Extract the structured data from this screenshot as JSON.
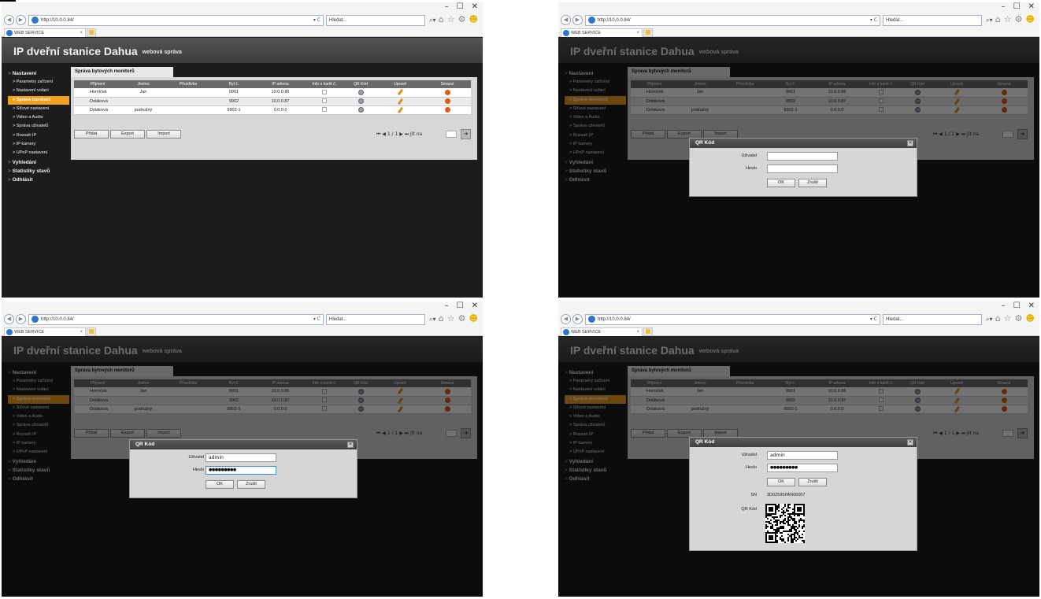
{
  "browser": {
    "window_controls": [
      "–",
      "☐",
      "✕"
    ],
    "address": "http://10.0.0.84/",
    "address_tail": "▾ Ċ",
    "search_placeholder": "Hledat...",
    "search_icon": "⌕▾",
    "toolbar_icons": [
      "⌂",
      "☆",
      "⚙",
      "☻"
    ],
    "tab_title": "WEB SERVICE",
    "tab_close": "×"
  },
  "page": {
    "title": "IP dveřní stanice Dahua",
    "subtitle": "webová správa"
  },
  "sidebar": {
    "sections": [
      {
        "label": "Nastavení",
        "items": [
          "Parametry zařízení",
          "Nastavení volání",
          "Správa monitorů",
          "Síťové nastavení",
          "Video a Audio",
          "Správa uživatelů",
          "Rozsah IP",
          "IP kamery",
          "UPnP nastavení"
        ]
      },
      {
        "label": "Vyhledání",
        "items": []
      },
      {
        "label": "Statistiky stavů",
        "items": []
      },
      {
        "label": "Odhlásit",
        "items": []
      }
    ],
    "active_item": "Správa monitorů"
  },
  "content": {
    "tab": "Správa bytových monitorů",
    "columns": [
      "Příjmení",
      "Jméno",
      "Přezdívka",
      "Byt č.",
      "IP adresa",
      "Info o kartě č.",
      "QR Kód",
      "Upravit",
      "Smazat"
    ],
    "rows": [
      {
        "surname": "Homíček",
        "name": "Jan",
        "nick": "",
        "flat": "9901",
        "ip": "10.0.0.86"
      },
      {
        "surname": "Doláková",
        "name": "",
        "nick": "",
        "flat": "9902",
        "ip": "10.0.0.87"
      },
      {
        "surname": "Doláková",
        "name": "podružný",
        "nick": "",
        "flat": "9902-1",
        "ip": "0.0.0.0"
      }
    ],
    "buttons": {
      "add": "Přidat",
      "export": "Export",
      "import": "Import"
    },
    "pager": "⏮ ◀ 1 / 1 ▶ ⏭ Jít na",
    "pager_go": "➔"
  },
  "dialog": {
    "title": "QR Kód",
    "close": "✕",
    "user_label": "Uživatel",
    "pass_label": "Heslo",
    "ok": "OK",
    "cancel": "Zrušit",
    "user_value": "admin",
    "pass_value": "●●●●●●●●●",
    "sn_label": "SN",
    "sn_value": "3D02595PAN00007",
    "qr_label": "QR Kód"
  }
}
